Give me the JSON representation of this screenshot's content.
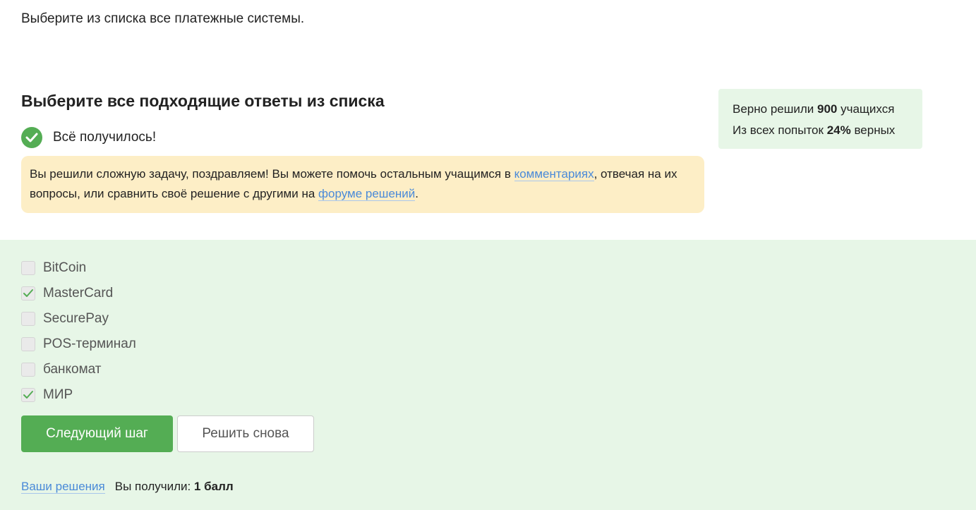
{
  "question": "Выберите из списка все платежные системы.",
  "task": {
    "title": "Выберите все подходящие ответы из списка",
    "status": "Всё получилось!"
  },
  "hint": {
    "before_comments": "Вы решили сложную задачу, поздравляем! Вы можете помочь остальным учащимся в ",
    "comments_link": "комментариях",
    "middle": ", отвечая на их вопросы, или сравнить своё решение с другими на ",
    "forum_link": "форуме решений",
    "end": "."
  },
  "stats": {
    "solved_prefix": "Верно решили ",
    "solved_count": "900",
    "solved_suffix": " учащихся",
    "attempts_prefix": "Из всех попыток ",
    "attempts_percent": "24%",
    "attempts_suffix": " верных"
  },
  "options": [
    {
      "label": "BitCoin",
      "checked": false
    },
    {
      "label": "MasterCard",
      "checked": true
    },
    {
      "label": "SecurePay",
      "checked": false
    },
    {
      "label": "POS-терминал",
      "checked": false
    },
    {
      "label": "банкомат",
      "checked": false
    },
    {
      "label": "МИР",
      "checked": true
    }
  ],
  "buttons": {
    "next": "Следующий шаг",
    "retry": "Решить снова"
  },
  "footer": {
    "solutions_link": "Ваши решения",
    "score_prefix": "Вы получили: ",
    "score_value": "1 балл"
  },
  "colors": {
    "accent_green": "#54ad54",
    "light_green": "#e7f6e7",
    "hint_yellow": "#fdeec6",
    "link_blue": "#4a8ad8"
  },
  "icons": {
    "status": "check-circle-icon",
    "checkbox_checked": "check-icon"
  }
}
